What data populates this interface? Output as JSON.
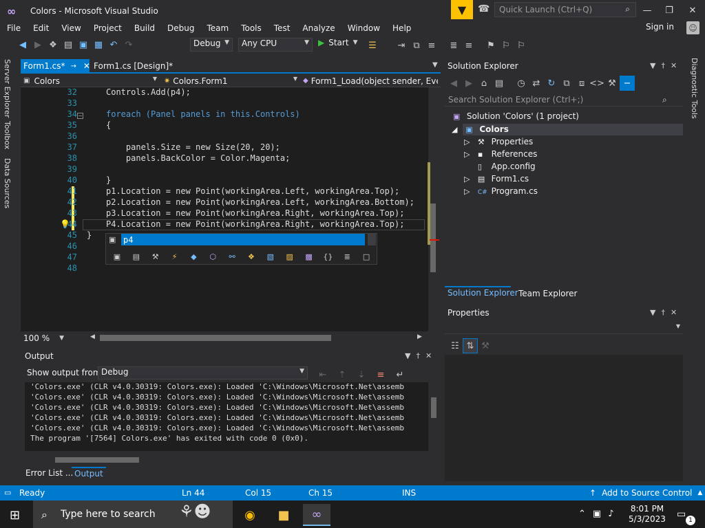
{
  "window": {
    "title": "Colors - Microsoft Visual Studio",
    "quick_launch_placeholder": "Quick Launch (Ctrl+Q)",
    "sign_in": "Sign in"
  },
  "menu": [
    "File",
    "Edit",
    "View",
    "Project",
    "Build",
    "Debug",
    "Team",
    "Tools",
    "Test",
    "Analyze",
    "Window",
    "Help"
  ],
  "toolbar": {
    "config": "Debug",
    "platform": "Any CPU",
    "start": "Start"
  },
  "left_strip": [
    "Server Explorer",
    "Toolbox",
    "Data Sources"
  ],
  "right_strip": [
    "Diagnostic Tools"
  ],
  "editor_tabs": [
    {
      "label": "Form1.cs*",
      "active": true
    },
    {
      "label": "Form1.cs [Design]*",
      "active": false
    }
  ],
  "navbar": {
    "project": "Colors",
    "class": "Colors.Form1",
    "member": "Form1_Load(object sender, Eve"
  },
  "editor": {
    "lines": [
      {
        "n": "32",
        "text": "Controls.Add(p4);"
      },
      {
        "n": "33",
        "text": ""
      },
      {
        "n": "34",
        "text": "foreach (Panel panels in this.Controls)"
      },
      {
        "n": "35",
        "text": "{"
      },
      {
        "n": "36",
        "text": ""
      },
      {
        "n": "37",
        "text": "    panels.Size = new Size(20, 20);"
      },
      {
        "n": "38",
        "text": "    panels.BackColor = Color.Magenta;"
      },
      {
        "n": "39",
        "text": ""
      },
      {
        "n": "40",
        "text": "}"
      },
      {
        "n": "41",
        "text": "p1.Location = new Point(workingArea.Left, workingArea.Top);"
      },
      {
        "n": "42",
        "text": "p2.Location = new Point(workingArea.Left, workingArea.Bottom);"
      },
      {
        "n": "43",
        "text": "p3.Location = new Point(workingArea.Right, workingArea.Top);"
      },
      {
        "n": "44",
        "text": "P4.Location = new Point(workingArea.Right, workingArea.Top);"
      },
      {
        "n": "45",
        "text": "}"
      },
      {
        "n": "46",
        "text": ""
      },
      {
        "n": "47",
        "text": ""
      },
      {
        "n": "48",
        "text": ""
      }
    ],
    "zoom": "100 %",
    "autocomplete_selected": "p4"
  },
  "output": {
    "title": "Output",
    "show_from_label": "Show output from:",
    "source": "Debug",
    "lines": [
      "'Colors.exe' (CLR v4.0.30319: Colors.exe): Loaded 'C:\\Windows\\Microsoft.Net\\assemb",
      "'Colors.exe' (CLR v4.0.30319: Colors.exe): Loaded 'C:\\Windows\\Microsoft.Net\\assemb",
      "'Colors.exe' (CLR v4.0.30319: Colors.exe): Loaded 'C:\\Windows\\Microsoft.Net\\assemb",
      "'Colors.exe' (CLR v4.0.30319: Colors.exe): Loaded 'C:\\Windows\\Microsoft.Net\\assemb",
      "'Colors.exe' (CLR v4.0.30319: Colors.exe): Loaded 'C:\\Windows\\Microsoft.Net\\assemb",
      "The program '[7564] Colors.exe' has exited with code 0 (0x0)."
    ],
    "tabs": [
      "Error List ...",
      "Output"
    ]
  },
  "solution_explorer": {
    "title": "Solution Explorer",
    "search_placeholder": "Search Solution Explorer (Ctrl+;)",
    "solution": "Solution 'Colors' (1 project)",
    "project": "Colors",
    "items": [
      "Properties",
      "References",
      "App.config",
      "Form1.cs",
      "Program.cs"
    ],
    "tabs": [
      "Solution Explorer",
      "Team Explorer"
    ]
  },
  "properties": {
    "title": "Properties"
  },
  "status": {
    "state": "Ready",
    "ln": "Ln 44",
    "col": "Col 15",
    "ch": "Ch 15",
    "mode": "INS",
    "source_control": "Add to Source Control"
  },
  "taskbar": {
    "search_placeholder": "Type here to search",
    "time": "8:01 PM",
    "date": "5/3/2023",
    "notification_count": "1"
  },
  "colors": {
    "accent": "#007acc",
    "background": "#2d2d30",
    "editor": "#1e1e1e",
    "keyword": "#569cd6",
    "type": "#4ec9b0",
    "line_number": "#2b91af"
  }
}
